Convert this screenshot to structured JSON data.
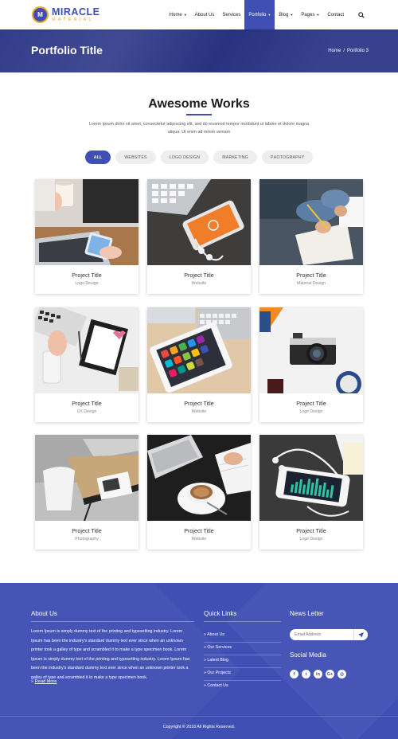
{
  "header": {
    "logo": {
      "main": "MIRACLE",
      "sub": "MATERIAL",
      "badge": "M"
    },
    "nav": [
      {
        "label": "Home",
        "dropdown": true
      },
      {
        "label": "About Us",
        "dropdown": false
      },
      {
        "label": "Services",
        "dropdown": false
      },
      {
        "label": "Portfolio",
        "dropdown": true,
        "active": true
      },
      {
        "label": "Blog",
        "dropdown": true
      },
      {
        "label": "Pages",
        "dropdown": true
      },
      {
        "label": "Contact",
        "dropdown": false
      }
    ],
    "search_icon": "search-icon"
  },
  "hero": {
    "title": "Portfolio Title",
    "breadcrumb": [
      "Home",
      "Portfolio 3"
    ]
  },
  "section": {
    "title": "Awesome Works",
    "description": "Lorem ipsum dolor sit amet, consectetur adipiscing elit, sed do eiusmod tempor incididunt ut labore et dolore magna aliqua. Ut enim ad minim veniam"
  },
  "filters": [
    {
      "label": "ALL",
      "active": true
    },
    {
      "label": "WEBSITES",
      "active": false
    },
    {
      "label": "LOGO DESIGN",
      "active": false
    },
    {
      "label": "MARKETING",
      "active": false
    },
    {
      "label": "PHOTOGRAPHY",
      "active": false
    }
  ],
  "projects": [
    {
      "title": "Project Title",
      "category": "Logo Design"
    },
    {
      "title": "Project Title",
      "category": "Website"
    },
    {
      "title": "Project Title",
      "category": "Material Design"
    },
    {
      "title": "Project Title",
      "category": "UX Design"
    },
    {
      "title": "Project Title",
      "category": "Website"
    },
    {
      "title": "Project Title",
      "category": "Logo Design"
    },
    {
      "title": "Project Title",
      "category": "Photography"
    },
    {
      "title": "Project Title",
      "category": "Website"
    },
    {
      "title": "Project Title",
      "category": "Logo Design"
    }
  ],
  "footer": {
    "about": {
      "heading": "About Us",
      "text": "Lorem Ipsum is simply dummy text of the printing and typesetting industry. Lorem Ipsum has been the industry's standard dummy text ever since when an unknown printer took a galley of type and scrambled it to make a type specimen book. Lorem Ipsum is simply dummy text of the printing and typesetting industry. Lorem Ipsum has been the industry's standard dummy text ever since when an unknown printer took a galley of type and scrambled it to make a type specimen book.",
      "read_more": "Read More"
    },
    "quick_links": {
      "heading": "Quick Links",
      "items": [
        "About Us",
        "Our Services",
        "Latest Blog",
        "Our Projects",
        "Contact Us"
      ]
    },
    "newsletter": {
      "heading": "News Letter",
      "placeholder": "Email Address"
    },
    "social": {
      "heading": "Social Media",
      "icons": [
        {
          "name": "facebook-icon",
          "glyph": "f"
        },
        {
          "name": "twitter-icon",
          "glyph": "t"
        },
        {
          "name": "linkedin-icon",
          "glyph": "in"
        },
        {
          "name": "google-plus-icon",
          "glyph": "G+"
        },
        {
          "name": "instagram-icon",
          "glyph": "◎"
        }
      ]
    },
    "copyright": "Copyright © 2018 All Rights Reserved."
  },
  "colors": {
    "primary": "#3f4fb3",
    "hero": "#2b3586",
    "accent": "#f5a623"
  }
}
